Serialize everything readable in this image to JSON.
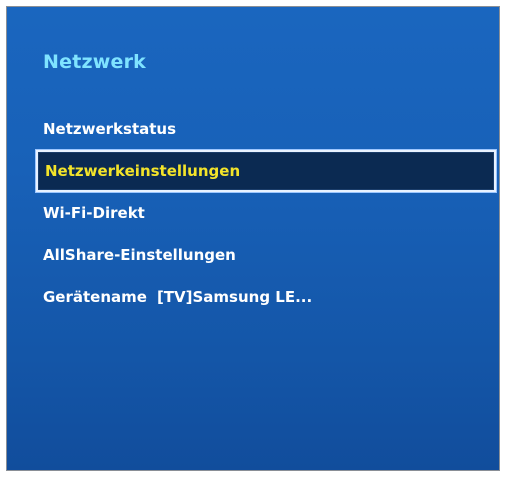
{
  "panel": {
    "title": "Netzwerk"
  },
  "menu": {
    "items": [
      {
        "label": "Netzwerkstatus"
      },
      {
        "label": "Netzwerkeinstellungen",
        "selected": true
      },
      {
        "label": "Wi-Fi-Direkt"
      },
      {
        "label": "AllShare-Einstellungen"
      },
      {
        "label": "Gerätename",
        "value": "[TV]Samsung LE..."
      }
    ]
  },
  "colors": {
    "background": "#1861b8",
    "title_text": "#7fe3ff",
    "item_text": "#ffffff",
    "selected_text": "#f3e42a",
    "selected_background": "#0b2a52"
  }
}
